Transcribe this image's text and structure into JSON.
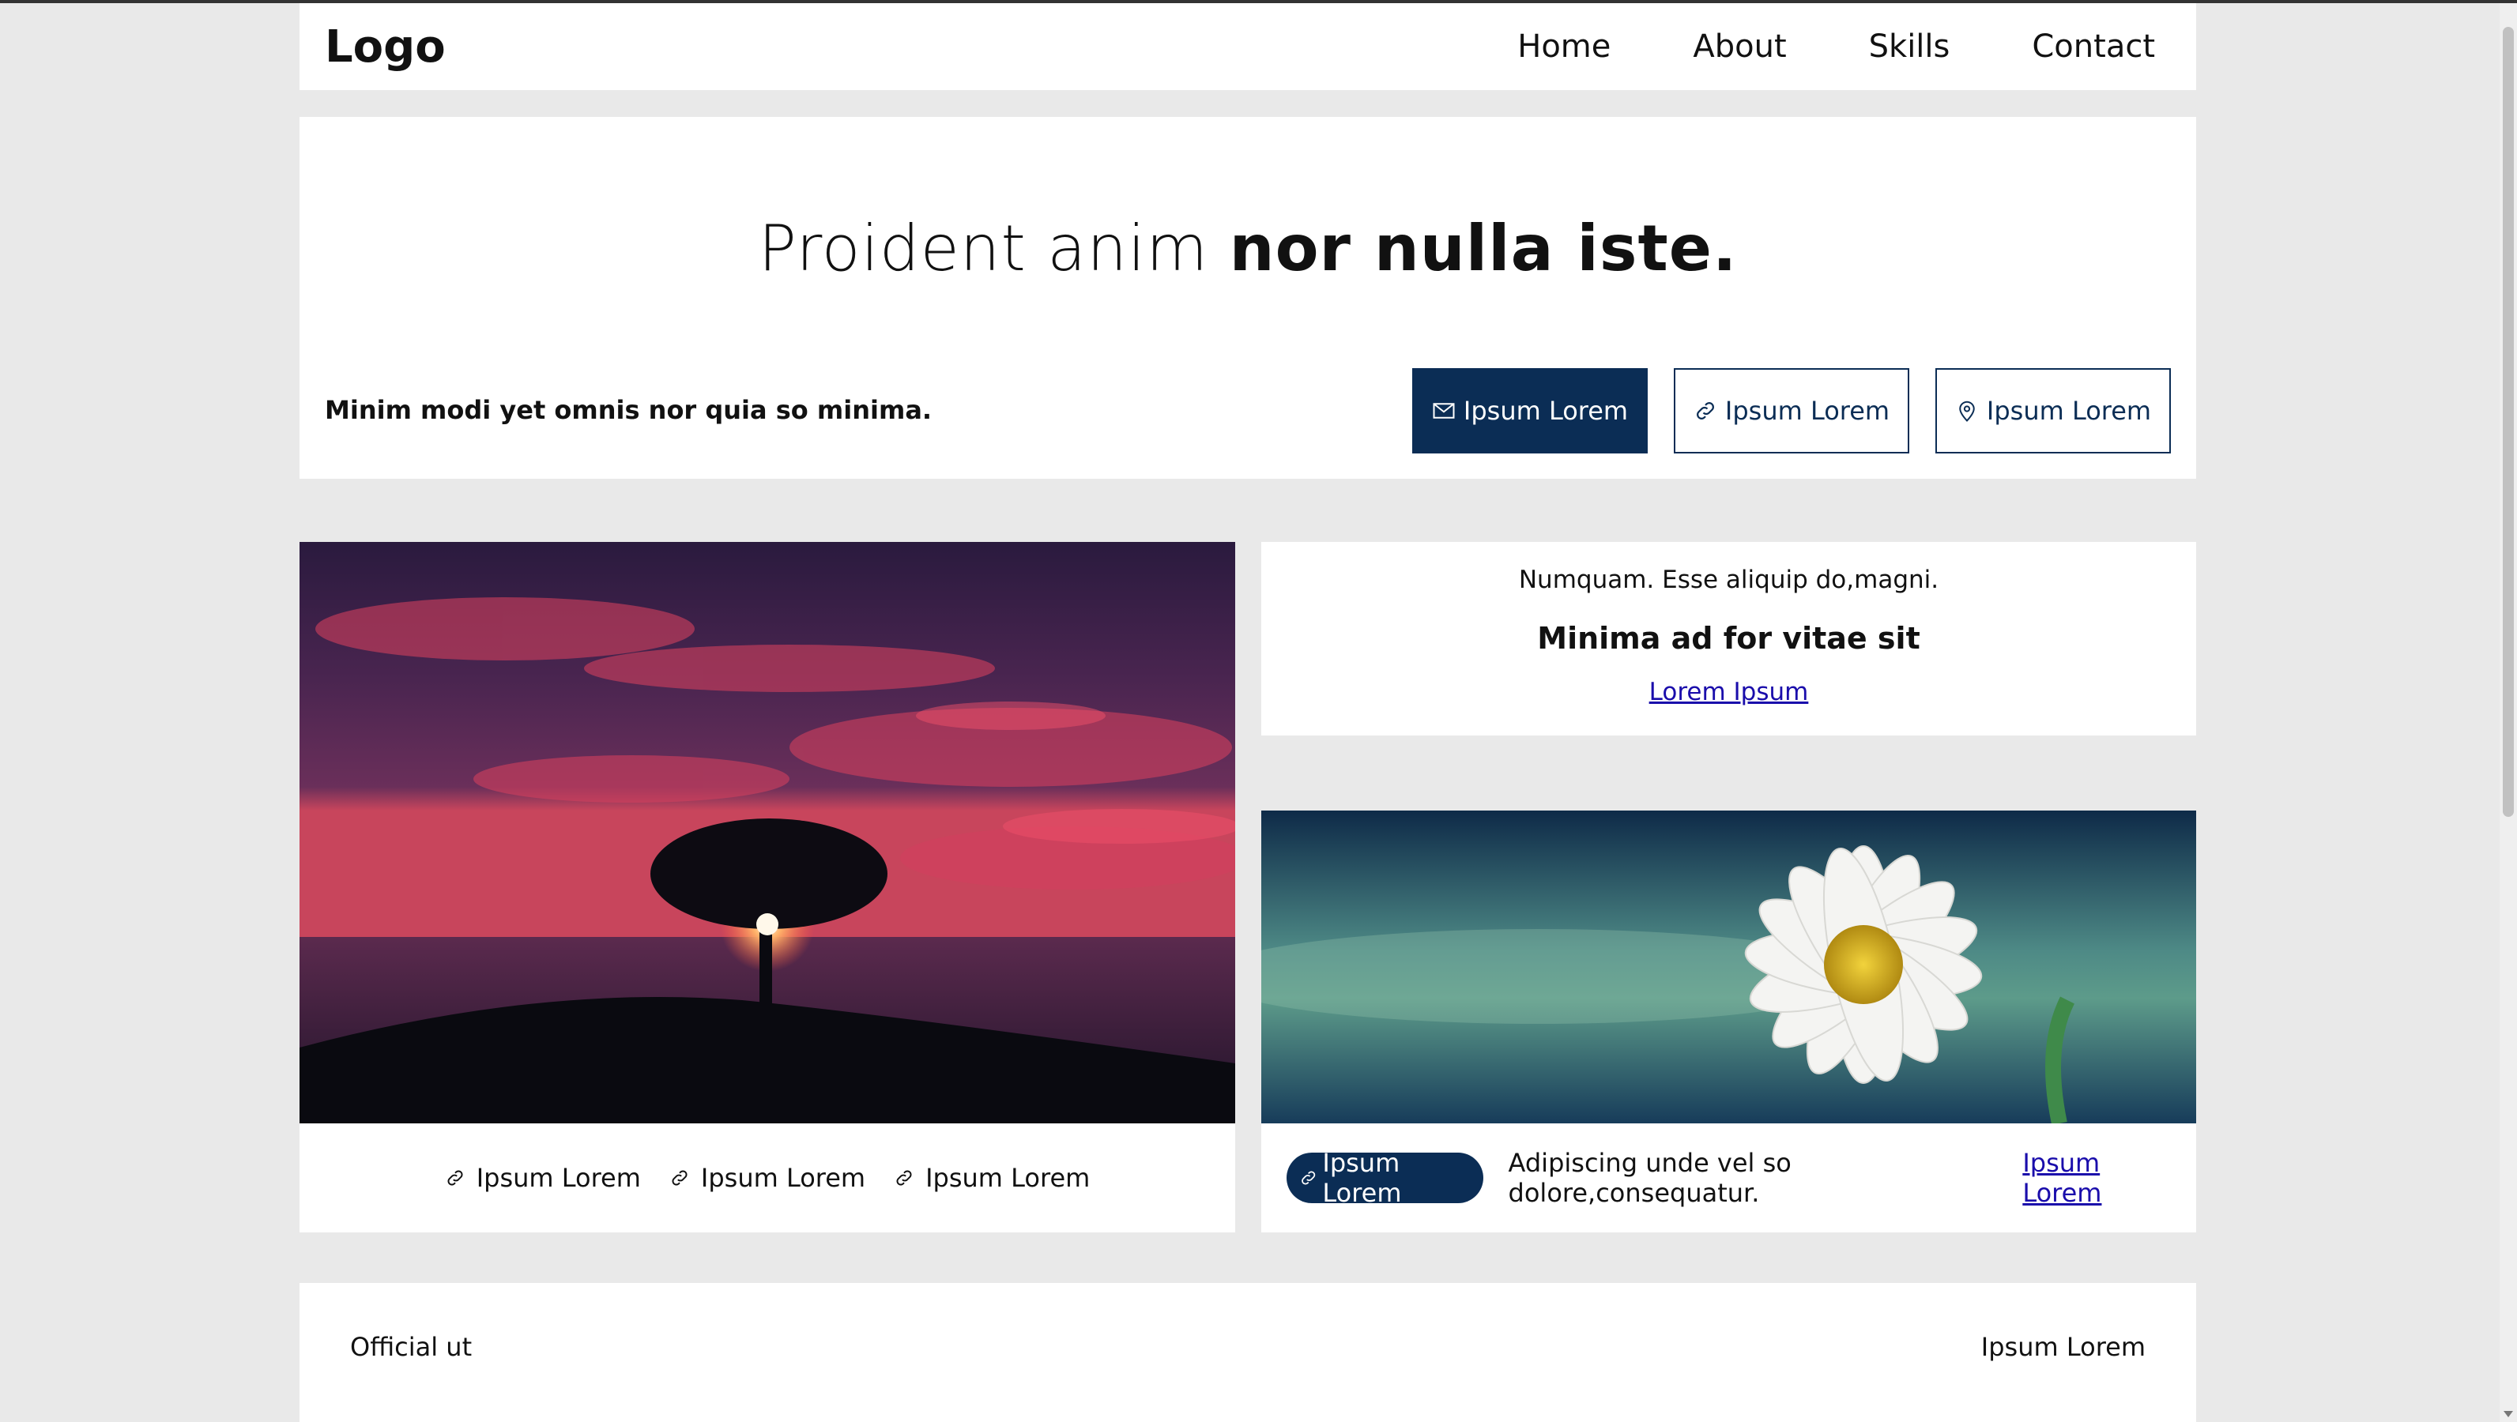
{
  "header": {
    "logo": "Logo",
    "nav": [
      "Home",
      "About",
      "Skills",
      "Contact"
    ]
  },
  "hero": {
    "title_light": "Proident anim ",
    "title_bold": "nor nulla iste.",
    "subtitle": "Minim modi yet omnis nor quia so minima.",
    "buttons": [
      {
        "label": "Ipsum Lorem",
        "icon": "mail-icon"
      },
      {
        "label": "Ipsum Lorem",
        "icon": "link-icon"
      },
      {
        "label": "Ipsum Lorem",
        "icon": "location-pin-icon"
      }
    ]
  },
  "card_left": {
    "image": "sunset-tree-image",
    "links": [
      "Ipsum Lorem",
      "Ipsum Lorem",
      "Ipsum Lorem"
    ]
  },
  "card_right_top": {
    "line1": "Numquam. Esse aliquip do,magni.",
    "heading": "Minima ad for vitae sit",
    "link": "Lorem Ipsum"
  },
  "card_right_bottom": {
    "image": "daisy-flower-image",
    "pill": "Ipsum Lorem",
    "text": "Adipiscing unde vel so dolore,consequatur.",
    "link": "Ipsum Lorem"
  },
  "footer": {
    "left": "Official ut",
    "right": "Ipsum Lorem"
  },
  "colors": {
    "primary": "#0b2d55",
    "link": "#1a0dab",
    "background": "#e9e9e9"
  }
}
